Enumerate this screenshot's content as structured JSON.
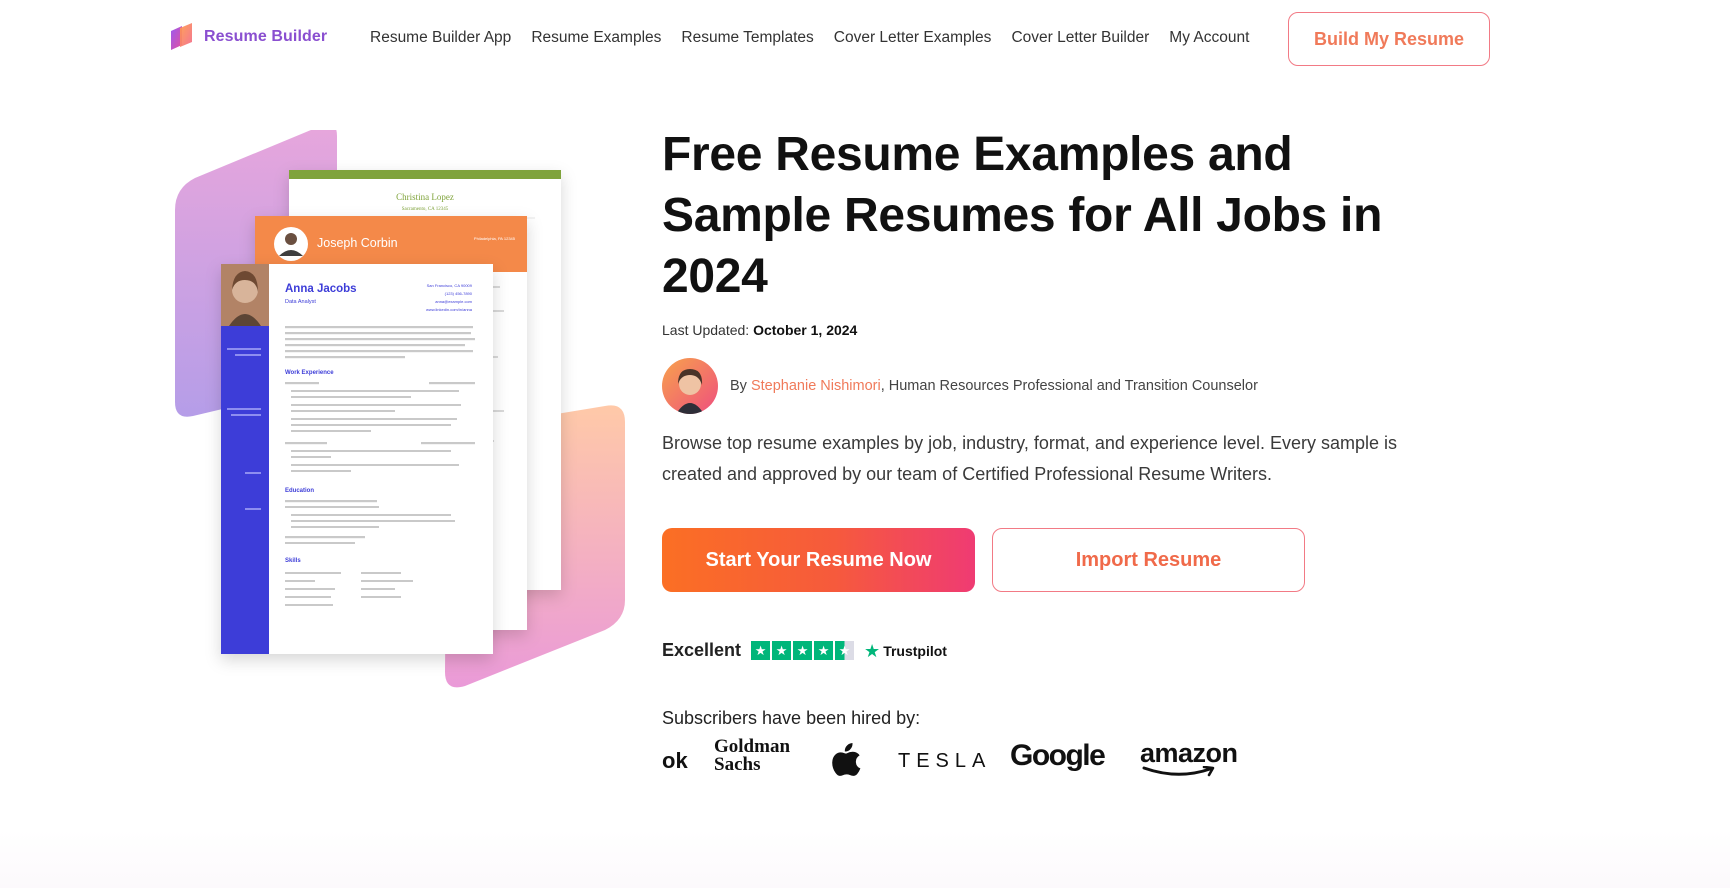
{
  "header": {
    "logo_text": "Resume Builder",
    "nav": [
      "Resume Builder App",
      "Resume Examples",
      "Resume Templates",
      "Cover Letter Examples",
      "Cover Letter Builder",
      "My Account"
    ],
    "cta_label": "Build My Resume"
  },
  "illustration": {
    "back_card": {
      "name": "Christina Lopez",
      "location": "Sacramento, CA 12345",
      "accent": "#7fa33a"
    },
    "middle_card": {
      "name": "Joseph Corbin",
      "location": "Philadelphia, PA 12345",
      "accent": "#f4894a"
    },
    "front_card": {
      "name": "Anna Jacobs",
      "role": "Data Analyst",
      "contact": [
        "San Francisco, CA 90009",
        "(123) 456-7890",
        "anna@example.com",
        "www.linkedin.com/in/anna"
      ],
      "sections": [
        "Work Experience",
        "Education",
        "Skills"
      ],
      "accent": "#3c3cd8"
    }
  },
  "hero": {
    "title": "Free Resume Examples and Sample Resumes for All Jobs in 2024",
    "updated_label": "Last Updated:",
    "updated_date": "October 1, 2024",
    "author_prefix": "By ",
    "author_name": "Stephanie Nishimori",
    "author_title": ", Human Resources Professional and Transition Counselor",
    "description": "Browse top resume examples by job, industry, format, and experience level. Every sample is created and approved by our team of Certified Professional Resume Writers.",
    "primary_button": "Start Your Resume Now",
    "secondary_button": "Import Resume"
  },
  "trust": {
    "label": "Excellent",
    "rating_stars": 4.5,
    "brand": "Trustpilot"
  },
  "hired": {
    "label": "Subscribers have been hired by:",
    "companies": [
      "ok",
      "Goldman Sachs",
      "Apple",
      "TESLA",
      "Google",
      "amazon"
    ]
  },
  "colors": {
    "brand_purple": "#8a4fd0",
    "accent_orange": "#f07a5a",
    "gradient_start": "#fb6f24",
    "gradient_end": "#ef3b73",
    "trustpilot_green": "#00b67a"
  }
}
